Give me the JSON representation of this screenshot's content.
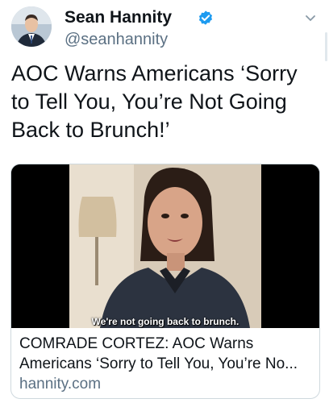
{
  "author": {
    "name": "Sean Hannity",
    "handle": "@seanhannity",
    "verified": true
  },
  "tweet": {
    "text_lines": [
      "AOC Warns Americans ‘Sorry",
      "to Tell You, You’re Not Going",
      "Back to Brunch!’"
    ]
  },
  "card": {
    "video_caption": "We're not going back to brunch.",
    "title_lines": [
      "COMRADE CORTEZ: AOC Warns",
      "Americans ‘Sorry to Tell You, You’re No..."
    ],
    "domain": "hannity.com"
  },
  "icons": {
    "verified": "verified-badge-icon",
    "more": "chevron-down-icon"
  },
  "colors": {
    "verified_blue": "#1d9bf0",
    "secondary_text": "#5b7083",
    "border": "#cfd9de"
  }
}
